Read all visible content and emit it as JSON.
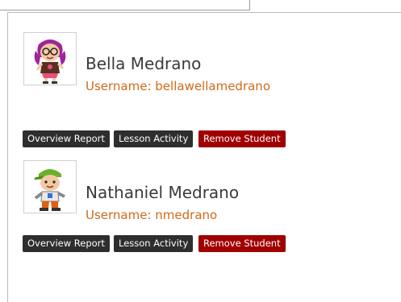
{
  "students": [
    {
      "name": "Bella Medrano",
      "username_text": "Username: bellawellamedrano",
      "avatar_icon": "girl-avatar-icon",
      "buttons": {
        "overview": "Overview Report",
        "lesson": "Lesson Activity",
        "remove": "Remove Student"
      }
    },
    {
      "name": "Nathaniel Medrano",
      "username_text": "Username: nmedrano",
      "avatar_icon": "boy-avatar-icon",
      "buttons": {
        "overview": "Overview Report",
        "lesson": "Lesson Activity",
        "remove": "Remove Student"
      }
    }
  ],
  "colors": {
    "name_text": "#3a3a3a",
    "username_text": "#cf6a1a",
    "button_dark": "#2e2e2e",
    "button_danger": "#a00000"
  }
}
